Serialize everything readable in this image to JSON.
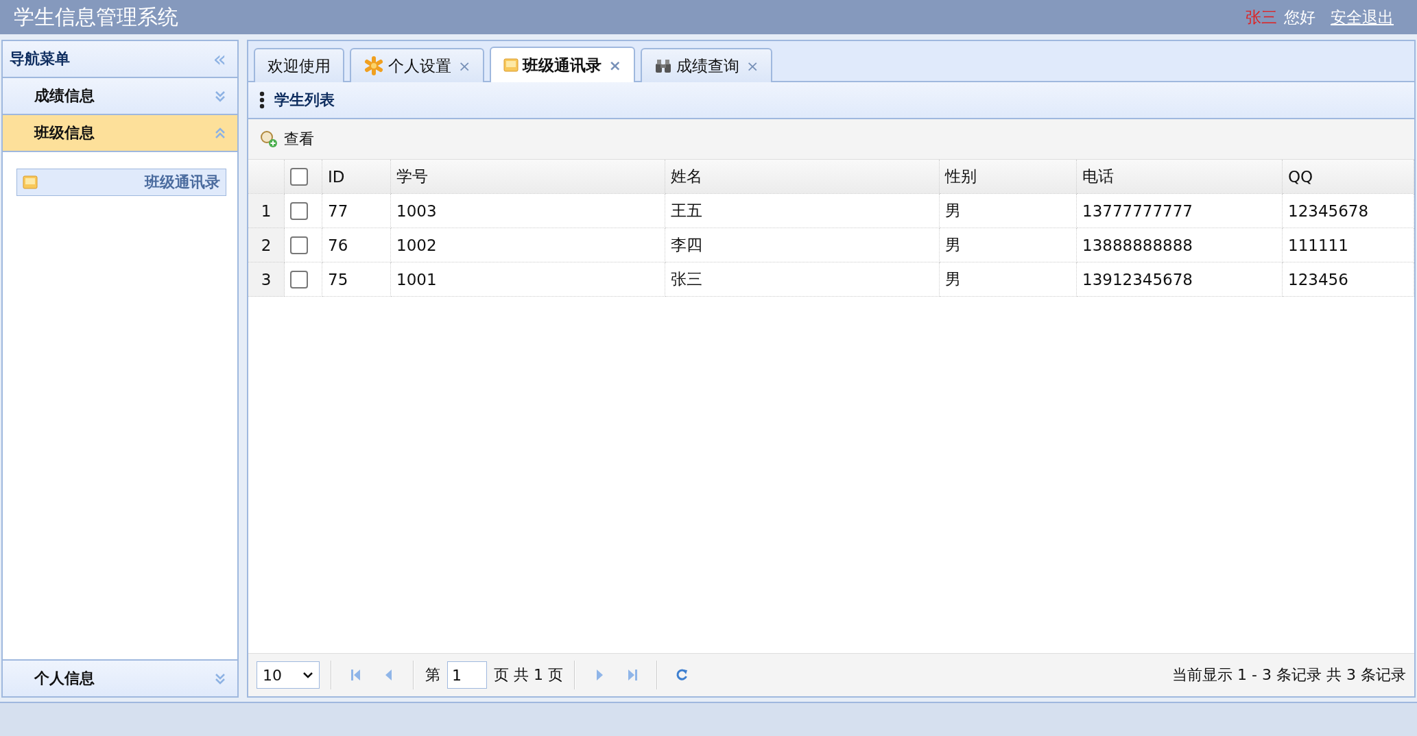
{
  "header": {
    "title": "学生信息管理系统",
    "user": "张三",
    "greeting": "您好",
    "logout": "安全退出"
  },
  "sidebar": {
    "title": "导航菜单",
    "collapse": "«",
    "sections": [
      {
        "label": "成绩信息",
        "expanded": false
      },
      {
        "label": "班级信息",
        "expanded": true,
        "items": [
          {
            "label": "班级通讯录",
            "selected": true
          }
        ]
      },
      {
        "label": "个人信息",
        "expanded": false
      }
    ]
  },
  "tabs": [
    {
      "label": "欢迎使用",
      "selected": false
    },
    {
      "label": "个人设置",
      "selected": false,
      "close": "×"
    },
    {
      "label": "班级通讯录",
      "selected": true,
      "close": "×"
    },
    {
      "label": "成绩查询",
      "selected": false,
      "close": "×"
    }
  ],
  "panel": {
    "title": "学生列表"
  },
  "toolbar": [
    {
      "label": "查看"
    }
  ],
  "table": {
    "columns": [
      "ID",
      "学号",
      "姓名",
      "性别",
      "电话",
      "QQ"
    ],
    "header_checked": false,
    "rows": [
      {
        "number": "1",
        "checked": false,
        "cells": [
          "77",
          "1003",
          "王五",
          "男",
          "13777777777",
          "12345678"
        ]
      },
      {
        "number": "2",
        "checked": false,
        "cells": [
          "76",
          "1002",
          "李四",
          "男",
          "13888888888",
          "111111"
        ]
      },
      {
        "number": "3",
        "checked": false,
        "cells": [
          "75",
          "1001",
          "张三",
          "男",
          "13912345678",
          "123456"
        ]
      }
    ]
  },
  "pager": {
    "page_size": "10",
    "page_prefix": "第",
    "page": "1",
    "page_suffix": "页 共 1 页",
    "summary": "当前显示 1 - 3 条记录 共 3 条记录"
  }
}
